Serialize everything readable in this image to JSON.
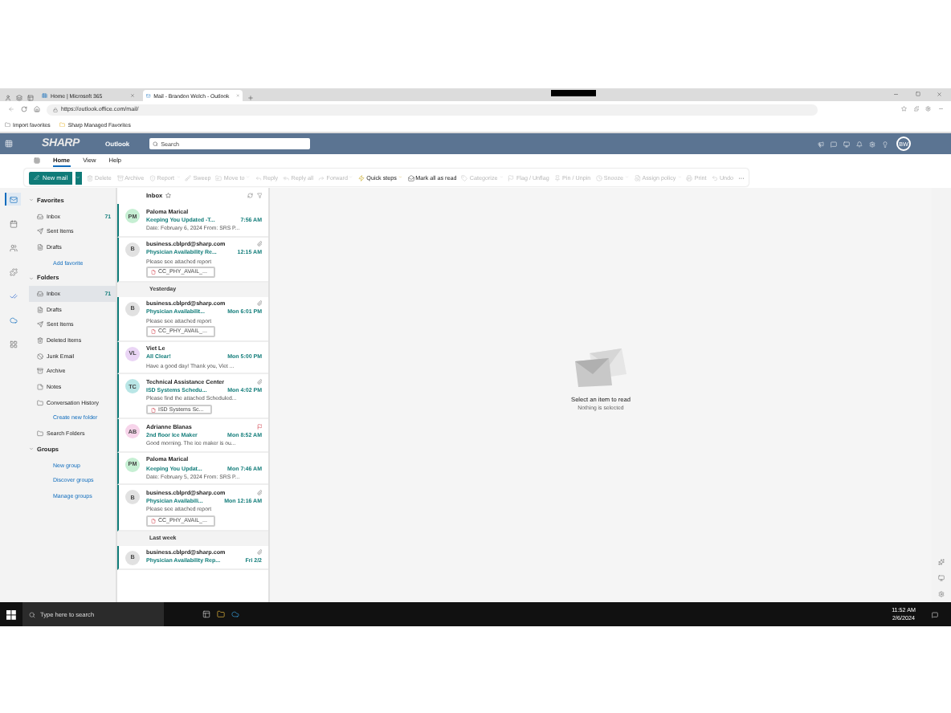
{
  "browser": {
    "tabs": [
      {
        "title": "Home | Microsoft 365",
        "selected": false
      },
      {
        "title": "Mail - Brandon Welch - Outlook",
        "selected": true
      }
    ],
    "url": "https://outlook.office.com/mail/",
    "favorites": [
      "Import favorites",
      "Sharp Managed Favorites"
    ]
  },
  "header": {
    "logo": "SHARP",
    "app": "Outlook",
    "search": {
      "placeholder": "Search"
    },
    "avatar": "BW"
  },
  "ribbon_tabs": [
    {
      "label": "Home",
      "selected": true
    },
    {
      "label": "View",
      "selected": false
    },
    {
      "label": "Help",
      "selected": false
    }
  ],
  "toolbar": {
    "new_mail": "New mail",
    "actions": [
      {
        "label": "Delete",
        "disabled": true,
        "dropdown": false
      },
      {
        "label": "Archive",
        "disabled": true,
        "dropdown": false
      },
      {
        "label": "Report",
        "disabled": true,
        "dropdown": true
      },
      {
        "label": "Sweep",
        "disabled": true,
        "dropdown": false
      },
      {
        "label": "Move to",
        "disabled": true,
        "dropdown": true
      },
      {
        "label": "Reply",
        "disabled": true,
        "dropdown": false
      },
      {
        "label": "Reply all",
        "disabled": true,
        "dropdown": false
      },
      {
        "label": "Forward",
        "disabled": true,
        "dropdown": true
      },
      {
        "label": "Quick steps",
        "disabled": false,
        "dropdown": true
      },
      {
        "label": "Mark all as read",
        "disabled": false,
        "dropdown": false
      },
      {
        "label": "Categorize",
        "disabled": true,
        "dropdown": true
      },
      {
        "label": "Flag / Unflag",
        "disabled": true,
        "dropdown": false
      },
      {
        "label": "Pin / Unpin",
        "disabled": true,
        "dropdown": false
      },
      {
        "label": "Snooze",
        "disabled": true,
        "dropdown": true
      },
      {
        "label": "Assign policy",
        "disabled": true,
        "dropdown": true
      },
      {
        "label": "Print",
        "disabled": true,
        "dropdown": false
      },
      {
        "label": "Undo",
        "disabled": true,
        "dropdown": false
      }
    ],
    "more": "···"
  },
  "rail": [
    {
      "selected": true
    },
    {
      "selected": false
    },
    {
      "selected": false
    },
    {
      "selected": false
    },
    {
      "selected": false
    },
    {
      "selected": false
    },
    {
      "selected": false
    }
  ],
  "folder_pane": [
    {
      "heading": "Favorites",
      "expanded": true,
      "items": [
        {
          "kind": "folder",
          "label": "Inbox",
          "count": "71",
          "selected": false
        },
        {
          "kind": "folder",
          "label": "Sent Items",
          "selected": false
        },
        {
          "kind": "folder",
          "label": "Drafts",
          "selected": false
        },
        {
          "kind": "link",
          "label": "Add favorite"
        }
      ]
    },
    {
      "heading": "Folders",
      "expanded": true,
      "items": [
        {
          "kind": "folder",
          "label": "Inbox",
          "count": "71",
          "selected": true
        },
        {
          "kind": "folder",
          "label": "Drafts",
          "selected": false
        },
        {
          "kind": "folder",
          "label": "Sent Items",
          "selected": false
        },
        {
          "kind": "folder",
          "label": "Deleted Items",
          "selected": false
        },
        {
          "kind": "folder",
          "label": "Junk Email",
          "selected": false
        },
        {
          "kind": "folder",
          "label": "Archive",
          "selected": false
        },
        {
          "kind": "folder",
          "label": "Notes",
          "selected": false
        },
        {
          "kind": "folder",
          "label": "Conversation History",
          "selected": false
        },
        {
          "kind": "link",
          "label": "Create new folder"
        },
        {
          "kind": "folder",
          "label": "Search Folders",
          "selected": false
        }
      ]
    },
    {
      "heading": "Groups",
      "expanded": true,
      "items": [
        {
          "kind": "link",
          "label": "New group"
        },
        {
          "kind": "link",
          "label": "Discover groups"
        },
        {
          "kind": "link",
          "label": "Manage groups"
        }
      ]
    }
  ],
  "message_list": {
    "title": "Inbox",
    "sections": [
      {
        "messages": [
          {
            "initials": "PM",
            "color": "#c6efd3",
            "sender": "Paloma Marical",
            "subject": "Keeping You Updated -T...",
            "time": "7:56 AM",
            "preview": "Date: February 6, 2024 From: SRS P...",
            "unread": true,
            "paperclip": false,
            "flagged": false
          },
          {
            "initials": "B",
            "color": "#e1e1e1",
            "sender": "business.cblprd@sharp.com",
            "subject": "Physician Availability Re...",
            "time": "12:15 AM",
            "preview": "Please see attached report",
            "attachment": "CC_PHY_AVAIL_...",
            "unread": true,
            "paperclip": true,
            "flagged": false
          }
        ]
      },
      {
        "label": "Yesterday",
        "messages": [
          {
            "initials": "B",
            "color": "#e1e1e1",
            "sender": "business.cblprd@sharp.com",
            "subject": "Physician Availabilit...",
            "time": "Mon 6:01 PM",
            "preview": "Please see attached report",
            "attachment": "CC_PHY_AVAIL_...",
            "unread": true,
            "paperclip": true,
            "flagged": false
          },
          {
            "initials": "VL",
            "color": "#ead5f5",
            "sender": "Viet Le",
            "subject": "All Clear!",
            "time": "Mon 5:00 PM",
            "preview": "Have a good day! Thank you, Viet ...",
            "unread": true,
            "paperclip": false,
            "flagged": false
          },
          {
            "initials": "TC",
            "color": "#b9e6e6",
            "sender": "Technical Assistance Center",
            "subject": "ISD Systems Schedu...",
            "time": "Mon 4:02 PM",
            "preview": "Please find the attached Scheduled...",
            "attachment": "ISD Systems Sc...",
            "unread": true,
            "paperclip": true,
            "flagged": false
          },
          {
            "initials": "AB",
            "color": "#f7d4ea",
            "sender": "Adrianne Blanas",
            "subject": "2nd floor Ice Maker",
            "time": "Mon 8:52 AM",
            "preview": "Good morning. The ice maker is ou...",
            "unread": true,
            "paperclip": false,
            "flagged": true
          },
          {
            "initials": "PM",
            "color": "#c6efd3",
            "sender": "Paloma Marical",
            "subject": "Keeping You Updat...",
            "time": "Mon 7:46 AM",
            "preview": "Date: February 5, 2024 From: SRS P...",
            "unread": true,
            "paperclip": false,
            "flagged": false
          },
          {
            "initials": "B",
            "color": "#e1e1e1",
            "sender": "business.cblprd@sharp.com",
            "subject": "Physician Availabili...",
            "time": "Mon 12:16 AM",
            "preview": "Please see attached report",
            "attachment": "CC_PHY_AVAIL_...",
            "unread": true,
            "paperclip": true,
            "flagged": false
          }
        ]
      },
      {
        "label": "Last week",
        "messages": [
          {
            "initials": "B",
            "color": "#e1e1e1",
            "sender": "business.cblprd@sharp.com",
            "subject": "Physician Availability Rep...",
            "time": "Fri 2/2",
            "unread": true,
            "paperclip": true,
            "flagged": false
          }
        ]
      }
    ]
  },
  "reading_pane": {
    "title": "Select an item to read",
    "subtitle": "Nothing is selected"
  },
  "taskbar": {
    "search": {
      "placeholder": "Type here to search"
    },
    "time": "11:52 AM",
    "date": "2/6/2024"
  }
}
